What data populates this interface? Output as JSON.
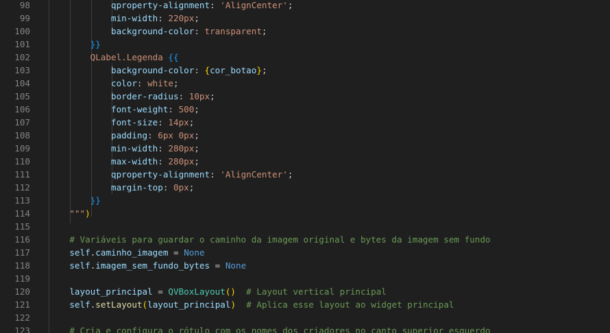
{
  "editor": {
    "colors": {
      "background": "#1f1f1f",
      "line_number": "#858585",
      "property": "#9cdcfe",
      "string": "#ce9178",
      "comment": "#6a9955",
      "keyword": "#569cd6",
      "function": "#dcdcaa",
      "class": "#4ec9b0",
      "bracket_magenta": "#da70d6",
      "bracket_blue": "#179fff",
      "bracket_gold": "#ffd700"
    },
    "lines": [
      {
        "num": "98",
        "indent": "            ",
        "tokens": [
          {
            "t": "qproperty-alignment",
            "c": "prop"
          },
          {
            "t": ": ",
            "c": "plain"
          },
          {
            "t": "'AlignCenter'",
            "c": "str"
          },
          {
            "t": ";",
            "c": "plain"
          }
        ]
      },
      {
        "num": "99",
        "indent": "            ",
        "tokens": [
          {
            "t": "min-width",
            "c": "prop"
          },
          {
            "t": ": ",
            "c": "plain"
          },
          {
            "t": "220px",
            "c": "str"
          },
          {
            "t": ";",
            "c": "plain"
          }
        ]
      },
      {
        "num": "100",
        "indent": "            ",
        "tokens": [
          {
            "t": "background-color",
            "c": "prop"
          },
          {
            "t": ": ",
            "c": "plain"
          },
          {
            "t": "transparent",
            "c": "str"
          },
          {
            "t": ";",
            "c": "plain"
          }
        ]
      },
      {
        "num": "101",
        "indent": "        ",
        "tokens": [
          {
            "t": "}}",
            "c": "brace2"
          }
        ]
      },
      {
        "num": "102",
        "indent": "        ",
        "tokens": [
          {
            "t": "QLabel.Legenda ",
            "c": "str"
          },
          {
            "t": "{{",
            "c": "brace2"
          }
        ]
      },
      {
        "num": "103",
        "indent": "            ",
        "tokens": [
          {
            "t": "background-color",
            "c": "prop"
          },
          {
            "t": ": ",
            "c": "plain"
          },
          {
            "t": "{",
            "c": "paren"
          },
          {
            "t": "cor_botao",
            "c": "var"
          },
          {
            "t": "}",
            "c": "paren"
          },
          {
            "t": ";",
            "c": "plain"
          }
        ]
      },
      {
        "num": "104",
        "indent": "            ",
        "tokens": [
          {
            "t": "color",
            "c": "prop"
          },
          {
            "t": ": ",
            "c": "plain"
          },
          {
            "t": "white",
            "c": "str"
          },
          {
            "t": ";",
            "c": "plain"
          }
        ]
      },
      {
        "num": "105",
        "indent": "            ",
        "tokens": [
          {
            "t": "border-radius",
            "c": "prop"
          },
          {
            "t": ": ",
            "c": "plain"
          },
          {
            "t": "10px",
            "c": "str"
          },
          {
            "t": ";",
            "c": "plain"
          }
        ]
      },
      {
        "num": "106",
        "indent": "            ",
        "tokens": [
          {
            "t": "font-weight",
            "c": "prop"
          },
          {
            "t": ": ",
            "c": "plain"
          },
          {
            "t": "500",
            "c": "str"
          },
          {
            "t": ";",
            "c": "plain"
          }
        ]
      },
      {
        "num": "107",
        "indent": "            ",
        "tokens": [
          {
            "t": "font-size",
            "c": "prop"
          },
          {
            "t": ": ",
            "c": "plain"
          },
          {
            "t": "14px",
            "c": "str"
          },
          {
            "t": ";",
            "c": "plain"
          }
        ]
      },
      {
        "num": "108",
        "indent": "            ",
        "tokens": [
          {
            "t": "padding",
            "c": "prop"
          },
          {
            "t": ": ",
            "c": "plain"
          },
          {
            "t": "6px 0px",
            "c": "str"
          },
          {
            "t": ";",
            "c": "plain"
          }
        ]
      },
      {
        "num": "109",
        "indent": "            ",
        "tokens": [
          {
            "t": "min-width",
            "c": "prop"
          },
          {
            "t": ": ",
            "c": "plain"
          },
          {
            "t": "280px",
            "c": "str"
          },
          {
            "t": ";",
            "c": "plain"
          }
        ]
      },
      {
        "num": "110",
        "indent": "            ",
        "tokens": [
          {
            "t": "max-width",
            "c": "prop"
          },
          {
            "t": ": ",
            "c": "plain"
          },
          {
            "t": "280px",
            "c": "str"
          },
          {
            "t": ";",
            "c": "plain"
          }
        ]
      },
      {
        "num": "111",
        "indent": "            ",
        "tokens": [
          {
            "t": "qproperty-alignment",
            "c": "prop"
          },
          {
            "t": ": ",
            "c": "plain"
          },
          {
            "t": "'AlignCenter'",
            "c": "str"
          },
          {
            "t": ";",
            "c": "plain"
          }
        ]
      },
      {
        "num": "112",
        "indent": "            ",
        "tokens": [
          {
            "t": "margin-top",
            "c": "prop"
          },
          {
            "t": ": ",
            "c": "plain"
          },
          {
            "t": "0px",
            "c": "str"
          },
          {
            "t": ";",
            "c": "plain"
          }
        ]
      },
      {
        "num": "113",
        "indent": "        ",
        "tokens": [
          {
            "t": "}}",
            "c": "brace2"
          }
        ]
      },
      {
        "num": "114",
        "indent": "    ",
        "tokens": [
          {
            "t": "\"\"\"",
            "c": "str"
          },
          {
            "t": ")",
            "c": "paren"
          }
        ]
      },
      {
        "num": "115",
        "indent": "",
        "tokens": []
      },
      {
        "num": "116",
        "indent": "    ",
        "tokens": [
          {
            "t": "# Variáveis para guardar o caminho da imagem original e bytes da imagem sem fundo",
            "c": "comment"
          }
        ]
      },
      {
        "num": "117",
        "indent": "    ",
        "tokens": [
          {
            "t": "self",
            "c": "var"
          },
          {
            "t": ".",
            "c": "plain"
          },
          {
            "t": "caminho_imagem",
            "c": "var"
          },
          {
            "t": " = ",
            "c": "plain"
          },
          {
            "t": "None",
            "c": "kw"
          }
        ]
      },
      {
        "num": "118",
        "indent": "    ",
        "tokens": [
          {
            "t": "self",
            "c": "var"
          },
          {
            "t": ".",
            "c": "plain"
          },
          {
            "t": "imagem_sem_fundo_bytes",
            "c": "var"
          },
          {
            "t": " = ",
            "c": "plain"
          },
          {
            "t": "None",
            "c": "kw"
          }
        ]
      },
      {
        "num": "119",
        "indent": "",
        "tokens": []
      },
      {
        "num": "120",
        "indent": "    ",
        "tokens": [
          {
            "t": "layout_principal",
            "c": "var"
          },
          {
            "t": " = ",
            "c": "plain"
          },
          {
            "t": "QVBoxLayout",
            "c": "class"
          },
          {
            "t": "()",
            "c": "paren"
          },
          {
            "t": "  ",
            "c": "plain"
          },
          {
            "t": "# Layout vertical principal",
            "c": "comment"
          }
        ]
      },
      {
        "num": "121",
        "indent": "    ",
        "tokens": [
          {
            "t": "self",
            "c": "var"
          },
          {
            "t": ".",
            "c": "plain"
          },
          {
            "t": "setLayout",
            "c": "func"
          },
          {
            "t": "(",
            "c": "paren"
          },
          {
            "t": "layout_principal",
            "c": "var"
          },
          {
            "t": ")",
            "c": "paren"
          },
          {
            "t": "  ",
            "c": "plain"
          },
          {
            "t": "# Aplica esse layout ao widget principal",
            "c": "comment"
          }
        ]
      },
      {
        "num": "122",
        "indent": "",
        "tokens": []
      },
      {
        "num": "123",
        "indent": "    ",
        "tokens": [
          {
            "t": "# Cria e configura o rótulo com os nomes dos criadores no canto superior esquerdo",
            "c": "comment"
          }
        ]
      }
    ]
  }
}
